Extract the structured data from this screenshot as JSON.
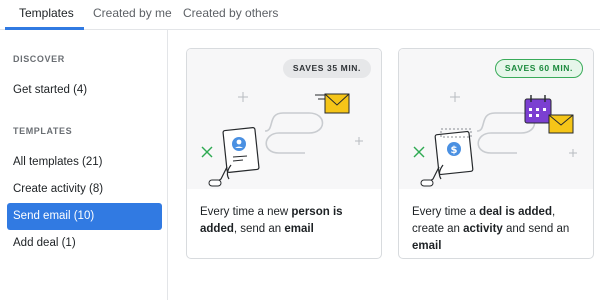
{
  "tabs": [
    "Templates",
    "Created by me",
    "Created by others"
  ],
  "sidebar": {
    "discover_heading": "DISCOVER",
    "get_started": "Get started (4)",
    "templates_heading": "TEMPLATES",
    "items": [
      "All templates (21)",
      "Create activity (8)",
      "Send email (10)",
      "Add deal (1)"
    ],
    "selected_index": 2
  },
  "cards": [
    {
      "badge": "SAVES 35 MIN.",
      "text": {
        "p1": "Every time a new ",
        "b1": "person is added",
        "p2": ", send an ",
        "b2": "email",
        "p3": "",
        "b3": ""
      }
    },
    {
      "badge": "SAVES 60 MIN.",
      "text": {
        "p1": "Every time a ",
        "b1": "deal is added",
        "p2": ", create an ",
        "b2": "activity",
        "p3": " and send an ",
        "b3": "email"
      }
    }
  ],
  "colors": {
    "accent": "#317ae2",
    "email_yellow": "#f5c518",
    "calendar_purple": "#7b3fd1",
    "badge_green": "#3aab5a"
  },
  "icons": [
    "person-card-icon",
    "envelope-icon",
    "calendar-icon",
    "dollar-clipboard-icon",
    "sparkle-icon"
  ]
}
